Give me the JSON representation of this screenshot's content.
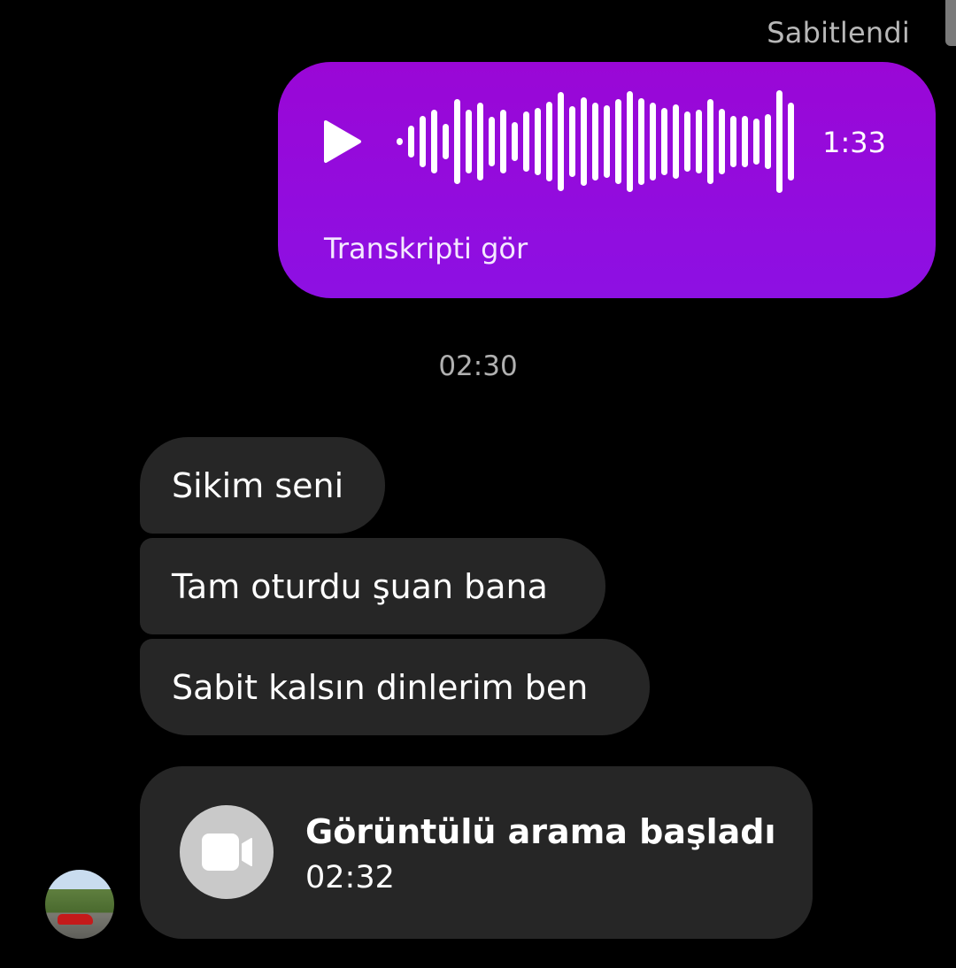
{
  "header": {
    "pinned_label": "Sabitlendi"
  },
  "voice_message": {
    "duration": "1:33",
    "transcript_link": "Transkripti gör",
    "bubble_color": "#9a07d6",
    "icon": "play-icon"
  },
  "timestamp": "02:30",
  "messages": [
    {
      "text": "Sikim seni"
    },
    {
      "text": "Tam oturdu şuan bana"
    },
    {
      "text": "Sabit kalsın dinlerim ben"
    }
  ],
  "call": {
    "title": "Görüntülü arama başladı",
    "time": "02:32",
    "icon": "video-camera-icon"
  },
  "avatar": {
    "icon": "avatar"
  }
}
